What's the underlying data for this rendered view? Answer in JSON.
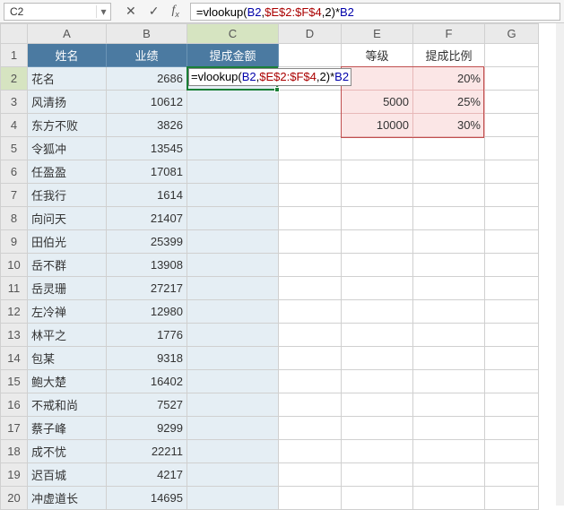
{
  "namebox": {
    "value": "C2"
  },
  "formula_bar": {
    "segments": {
      "eq": "=",
      "fn": "vlookup",
      "open": "(",
      "ref1": "B2",
      "c1": ",",
      "rng": "$E$2:$F$4",
      "c2": ",",
      "n": "2",
      "close": ")",
      "mul": "*",
      "ref2": "B2"
    }
  },
  "columns": [
    "A",
    "B",
    "C",
    "D",
    "E",
    "F",
    "G"
  ],
  "rows": [
    "1",
    "2",
    "3",
    "4",
    "5",
    "6",
    "7",
    "8",
    "9",
    "10",
    "11",
    "12",
    "13",
    "14",
    "15",
    "16",
    "17",
    "18",
    "19",
    "20"
  ],
  "header_row": {
    "A": "姓名",
    "B": "业绩",
    "C": "提成金额",
    "E": "等级",
    "F": "提成比例"
  },
  "table_A": [
    {
      "name": "花名",
      "perf": "2686"
    },
    {
      "name": "风清扬",
      "perf": "10612"
    },
    {
      "name": "东方不败",
      "perf": "3826"
    },
    {
      "name": "令狐冲",
      "perf": "13545"
    },
    {
      "name": "任盈盈",
      "perf": "17081"
    },
    {
      "name": "任我行",
      "perf": "1614"
    },
    {
      "name": "向问天",
      "perf": "21407"
    },
    {
      "name": "田伯光",
      "perf": "25399"
    },
    {
      "name": "岳不群",
      "perf": "13908"
    },
    {
      "name": "岳灵珊",
      "perf": "27217"
    },
    {
      "name": "左冷禅",
      "perf": "12980"
    },
    {
      "name": "林平之",
      "perf": "1776"
    },
    {
      "name": "包某",
      "perf": "9318"
    },
    {
      "name": "鲍大楚",
      "perf": "16402"
    },
    {
      "name": "不戒和尚",
      "perf": "7527"
    },
    {
      "name": "蔡子峰",
      "perf": "9299"
    },
    {
      "name": "成不忧",
      "perf": "22211"
    },
    {
      "name": "迟百城",
      "perf": "4217"
    },
    {
      "name": "冲虚道长",
      "perf": "14695"
    }
  ],
  "lookup": [
    {
      "lvl": "",
      "rate": "20%"
    },
    {
      "lvl": "5000",
      "rate": "25%"
    },
    {
      "lvl": "10000",
      "rate": "30%"
    }
  ],
  "inline_formula": "=vlookup(B2,$E$2:$F$4,2)*B2",
  "active_cell": "C2"
}
